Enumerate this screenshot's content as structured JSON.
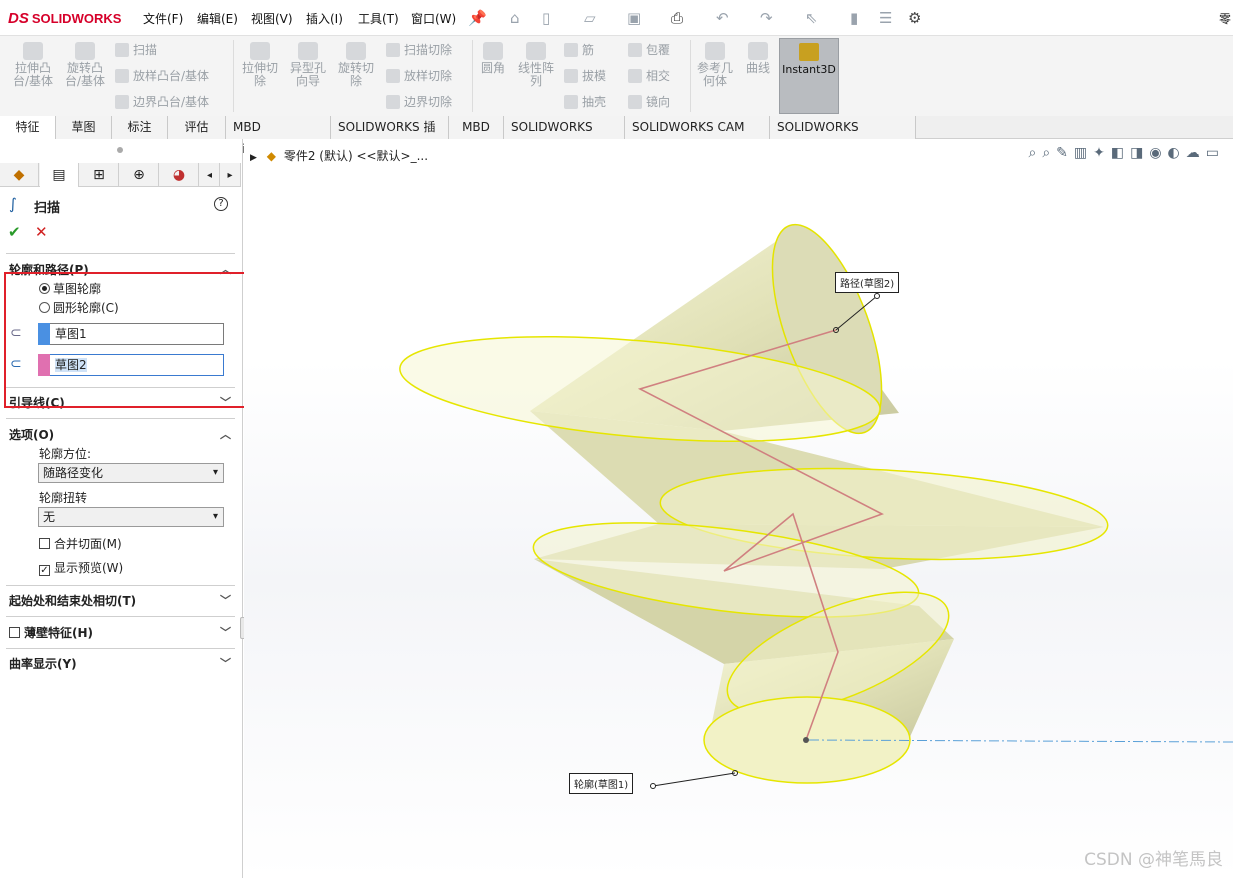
{
  "app": {
    "brand": "SOLIDWORKS",
    "brand_mark": "DS"
  },
  "menu": [
    "文件(F)",
    "编辑(E)",
    "视图(V)",
    "插入(I)",
    "工具(T)",
    "窗口(W)"
  ],
  "menu_right_cut": "零",
  "ribbon": {
    "big": [
      {
        "label": "拉伸凸\n台/基体"
      },
      {
        "label": "旋转凸\n台/基体"
      },
      {
        "label": "拉伸切\n除"
      },
      {
        "label": "异型孔\n向导"
      },
      {
        "label": "旋转切\n除"
      },
      {
        "label": "圆角"
      },
      {
        "label": "线性阵\n列"
      },
      {
        "label": "参考几\n何体"
      },
      {
        "label": "曲线"
      }
    ],
    "small": [
      "扫描",
      "放样凸台/基体",
      "边界凸台/基体",
      "扫描切除",
      "放样切除",
      "边界切除",
      "筋",
      "拔模",
      "抽壳",
      "包覆",
      "相交",
      "镜向"
    ],
    "instant3d": "Instant3D"
  },
  "tabs": [
    "特征",
    "草图",
    "标注",
    "评估",
    "MBD Dimensions",
    "SOLIDWORKS 插件",
    "MBD",
    "SOLIDWORKS CAM",
    "SOLIDWORKS CAM TBM",
    "SOLIDWORKS Inspection"
  ],
  "panel": {
    "title": "扫描",
    "help": "?",
    "ok": "✔",
    "cancel": "✕",
    "sec_profile": "轮廓和路径(P)",
    "radio1": "草图轮廓",
    "radio2": "圆形轮廓(C)",
    "profile_field": "草图1",
    "path_field": "草图2",
    "sec_guide": "引导线(C)",
    "sec_options": "选项(O)",
    "orient_label": "轮廓方位:",
    "orient_value": "随路径变化",
    "twist_label": "轮廓扭转",
    "twist_value": "无",
    "merge": "合并切面(M)",
    "preview": "显示预览(W)",
    "sec_tangent": "起始处和结束处相切(T)",
    "sec_thin": "薄壁特征(H)",
    "sec_curv": "曲率显示(Y)"
  },
  "viewport": {
    "tree_label": "零件2 (默认) <<默认>_...",
    "callout_path": "路径(草图2)",
    "callout_profile": "轮廓(草图1)",
    "watermark": "CSDN @神笔馬良"
  },
  "colors": {
    "accent_red": "#e0202a",
    "sweep_fill": "#eeeec0",
    "sweep_edge": "#e8e800",
    "path_color": "#d08080"
  }
}
